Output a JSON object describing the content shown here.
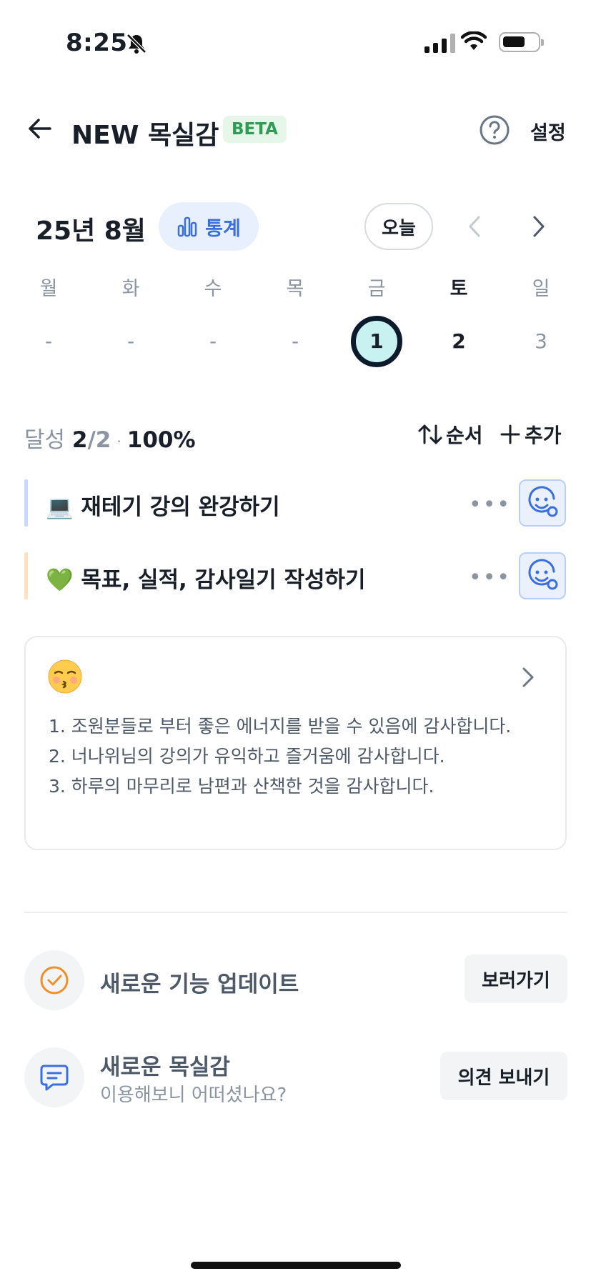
{
  "status_bar": {
    "time": "8:25"
  },
  "header": {
    "title": "NEW 목실감",
    "badge": "BETA",
    "settings": "설정"
  },
  "calendar": {
    "month": "25년 8월",
    "stats_label": "통계",
    "today_label": "오늘",
    "weekdays": [
      "월",
      "화",
      "수",
      "목",
      "금",
      "토",
      "일"
    ],
    "dates": [
      "-",
      "-",
      "-",
      "-",
      "1",
      "2",
      "3"
    ]
  },
  "summary": {
    "label": "달성",
    "done": "2",
    "total": "/2",
    "separator": "·",
    "percent": "100%",
    "order_label": "순서",
    "add_label": "추가"
  },
  "tasks": [
    {
      "emoji": "💻",
      "text": "재테기 강의 완강하기",
      "color": "#c9d9fb"
    },
    {
      "emoji": "💚",
      "text": "목표, 실적, 감사일기 작성하기",
      "color": "#fde3c2"
    }
  ],
  "journal": {
    "emoji": "😚",
    "line1": "1. 조원분들로 부터 좋은 에너지를 받을 수 있음에 감사합니다.",
    "line2": "2. 너나위님의 강의가 유익하고 즐거움에 감사합니다.",
    "line3": "3. 하루의 마무리로 남편과 산책한 것을 감사합니다."
  },
  "promos": {
    "update": {
      "title": "새로운 기능 업데이트",
      "button": "보러가기"
    },
    "feedback": {
      "title": "새로운 목실감",
      "subtitle": "이용해보니 어떠셨나요?",
      "button": "의견 보내기"
    }
  },
  "colors": {
    "accent": "#3b6fe0",
    "beta_bg": "#e6f7ea",
    "beta_text": "#2e9c55",
    "selected_day": "#c8f2f2"
  }
}
